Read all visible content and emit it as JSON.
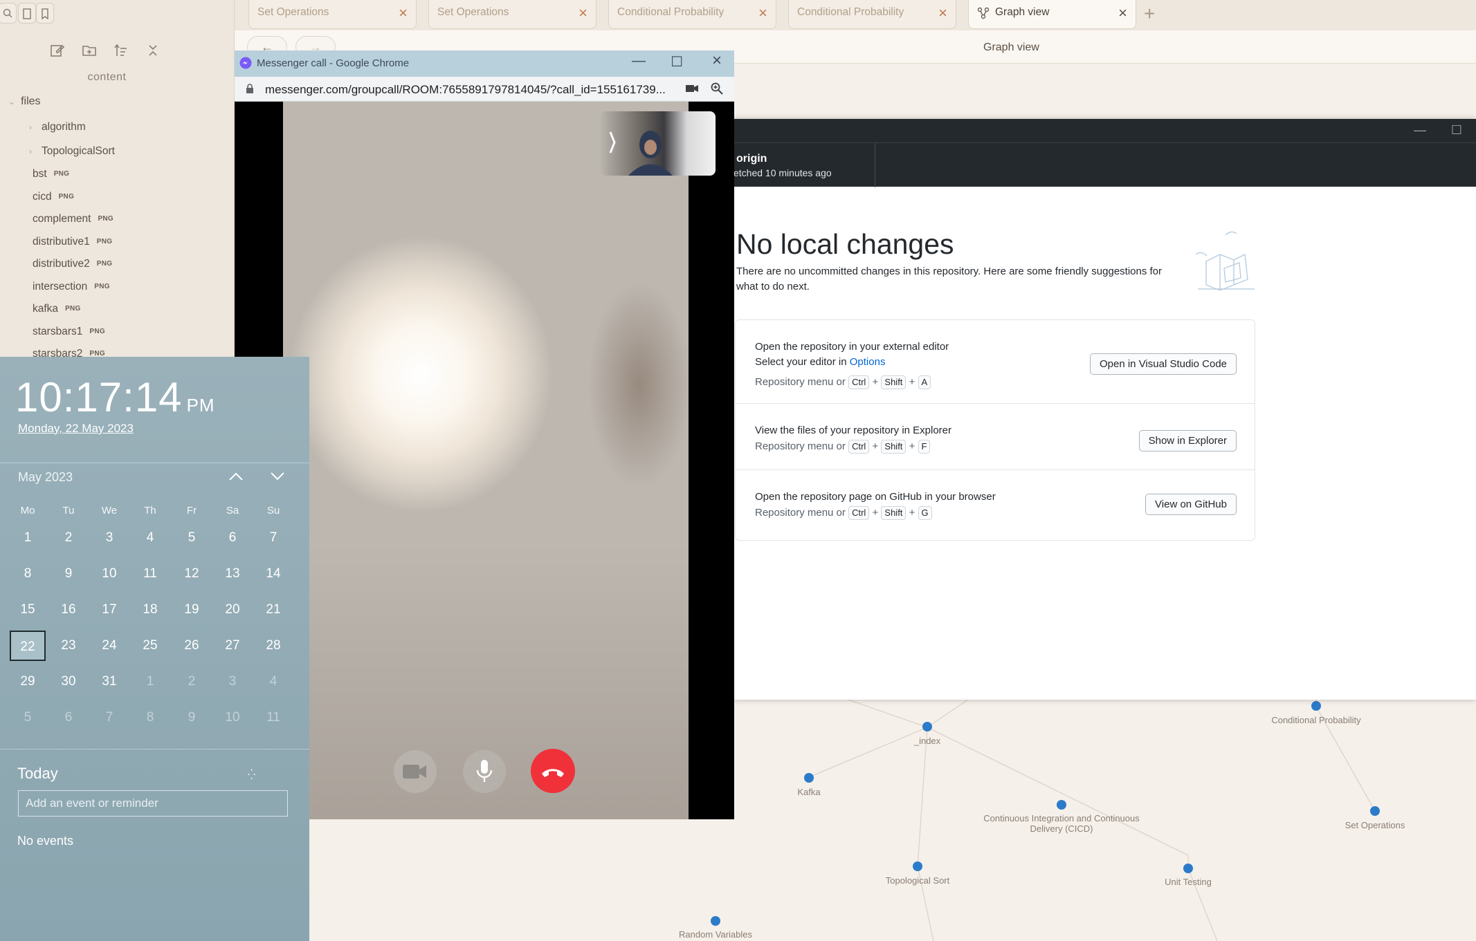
{
  "obsidian": {
    "content_label": "content",
    "files_label": "files",
    "folders": [
      {
        "label": "algorithm"
      },
      {
        "label": "TopologicalSort"
      }
    ],
    "files": [
      {
        "name": "bst",
        "badge": "PNG"
      },
      {
        "name": "cicd",
        "badge": "PNG"
      },
      {
        "name": "complement",
        "badge": "PNG"
      },
      {
        "name": "distributive1",
        "badge": "PNG"
      },
      {
        "name": "distributive2",
        "badge": "PNG"
      },
      {
        "name": "intersection",
        "badge": "PNG"
      },
      {
        "name": "kafka",
        "badge": "PNG"
      },
      {
        "name": "starsbars1",
        "badge": "PNG"
      },
      {
        "name": "starsbars2",
        "badge": "PNG"
      }
    ],
    "tabs": [
      {
        "label": "Set Operations"
      },
      {
        "label": "Set Operations"
      },
      {
        "label": "Conditional Probability"
      },
      {
        "label": "Conditional Probability"
      },
      {
        "label": "Graph view"
      }
    ],
    "view_title": "Graph view",
    "graph_nodes": [
      {
        "label": "_index"
      },
      {
        "label": "Conditional Probability"
      },
      {
        "label": "Kafka"
      },
      {
        "label": "Continuous Integration and Continuous Delivery (CICD)"
      },
      {
        "label": "Set Operations"
      },
      {
        "label": "Topological Sort"
      },
      {
        "label": "Unit Testing"
      },
      {
        "label": "Random Variables"
      }
    ]
  },
  "github": {
    "repo_remote": "origin",
    "fetched": "etched 10 minutes ago",
    "heading": "No local changes",
    "subtitle": "There are no uncommitted changes in this repository. Here are some friendly suggestions for what to do next.",
    "rows": [
      {
        "title": "Open the repository in your external editor",
        "line2_prefix": "Select your editor in ",
        "line2_link": "Options",
        "shortcut_prefix": "Repository menu or",
        "keys": [
          "Ctrl",
          "Shift",
          "A"
        ],
        "button": "Open in Visual Studio Code"
      },
      {
        "title": "View the files of your repository in Explorer",
        "shortcut_prefix": "Repository menu or",
        "keys": [
          "Ctrl",
          "Shift",
          "F"
        ],
        "button": "Show in Explorer"
      },
      {
        "title": "Open the repository page on GitHub in your browser",
        "shortcut_prefix": "Repository menu or",
        "keys": [
          "Ctrl",
          "Shift",
          "G"
        ],
        "button": "View on GitHub"
      }
    ]
  },
  "chrome": {
    "window_title": "Messenger call - Google Chrome",
    "url": "messenger.com/groupcall/ROOM:7655891797814045/?call_id=155161739..."
  },
  "clock": {
    "time": "10:17:14",
    "ampm": "PM",
    "date": "Monday, 22 May 2023",
    "month": "May 2023",
    "weekdays": [
      "Mo",
      "Tu",
      "We",
      "Th",
      "Fr",
      "Sa",
      "Su"
    ],
    "weeks": [
      [
        "1",
        "2",
        "3",
        "4",
        "5",
        "6",
        "7"
      ],
      [
        "8",
        "9",
        "10",
        "11",
        "12",
        "13",
        "14"
      ],
      [
        "15",
        "16",
        "17",
        "18",
        "19",
        "20",
        "21"
      ],
      [
        "22",
        "23",
        "24",
        "25",
        "26",
        "27",
        "28"
      ],
      [
        "29",
        "30",
        "31",
        "1",
        "2",
        "3",
        "4"
      ],
      [
        "5",
        "6",
        "7",
        "8",
        "9",
        "10",
        "11"
      ]
    ],
    "today_label": "Today",
    "event_placeholder": "Add an event or reminder",
    "no_events": "No events"
  },
  "colors": {
    "graph_node": "#2b7bc9",
    "end_call": "#f0313a",
    "github_link": "#0366d6"
  }
}
